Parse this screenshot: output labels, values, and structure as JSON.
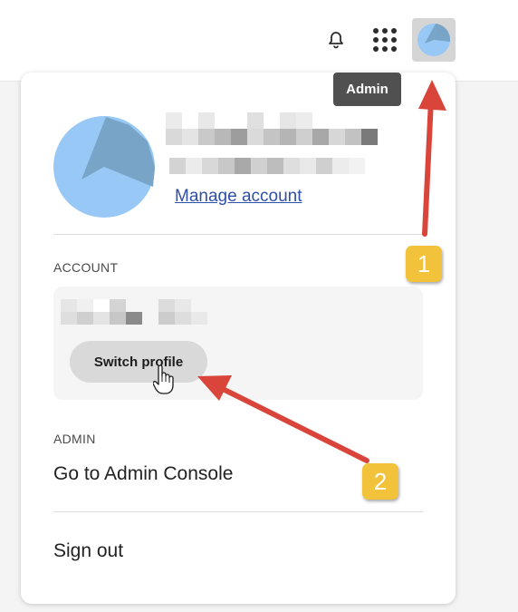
{
  "header": {
    "icons": [
      "bell-icon",
      "apps-grid-icon",
      "avatar-icon"
    ],
    "tooltip": "Admin"
  },
  "profile": {
    "manage_account_link": "Manage account"
  },
  "account_section": {
    "label": "ACCOUNT",
    "switch_profile_button": "Switch profile"
  },
  "admin_section": {
    "label": "ADMIN",
    "admin_console_link": "Go to Admin Console"
  },
  "sign_out_link": "Sign out",
  "annotations": {
    "badge_1": "1",
    "badge_2": "2"
  },
  "colors": {
    "arrow": "#d9453a",
    "badge": "#f2c33a",
    "avatar_light": "#98c8f6",
    "avatar_dark": "#78a4c8",
    "link": "#2f4fa8"
  }
}
